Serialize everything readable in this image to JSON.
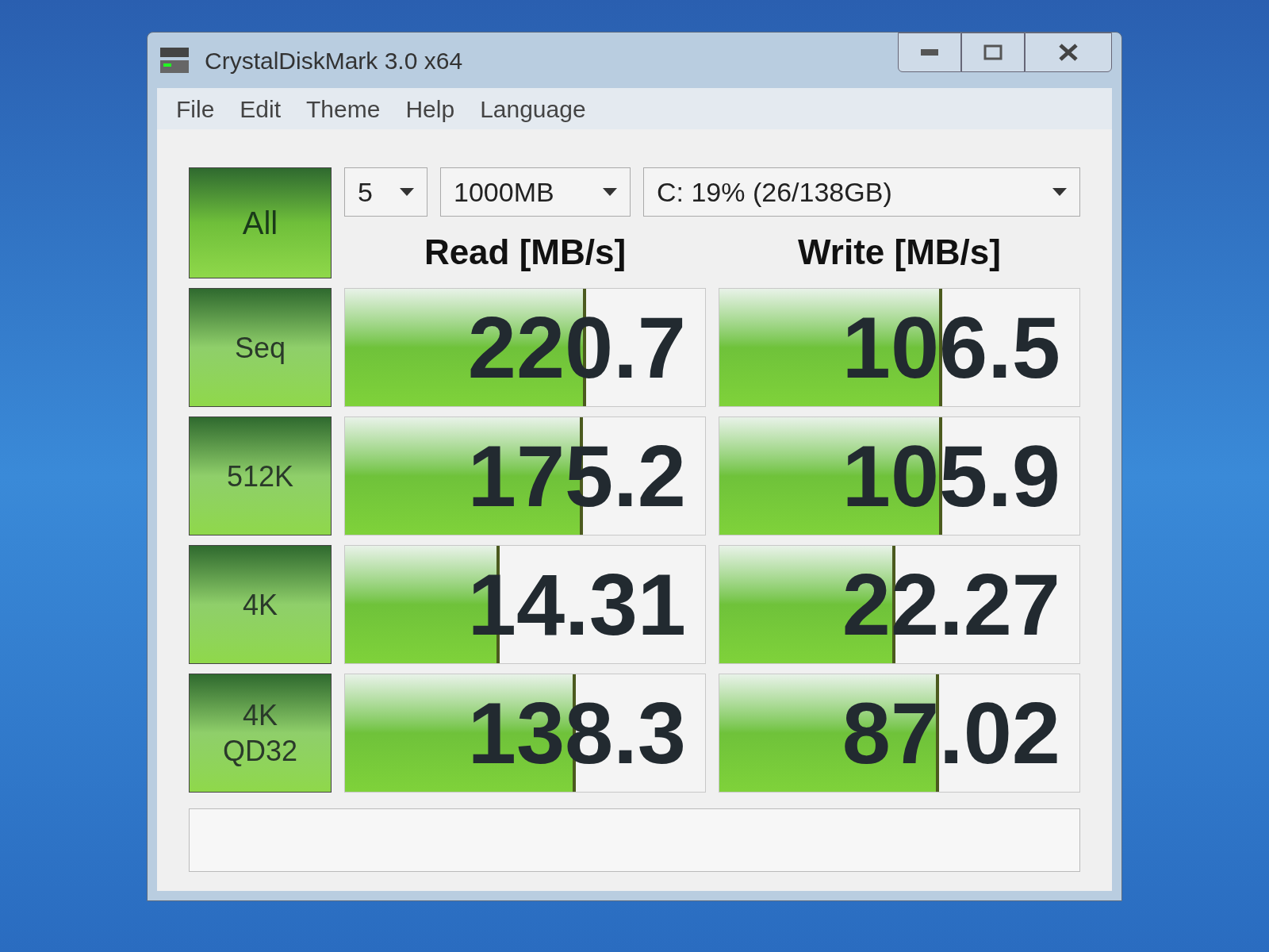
{
  "window": {
    "title": "CrystalDiskMark 3.0 x64"
  },
  "menu": [
    "File",
    "Edit",
    "Theme",
    "Help",
    "Language"
  ],
  "all_button": "All",
  "selectors": [
    {
      "value": "5"
    },
    {
      "value": "1000MB"
    },
    {
      "value": "C: 19% (26/138GB)"
    }
  ],
  "columns": [
    "Read [MB/s]",
    "Write [MB/s]"
  ],
  "rows": [
    {
      "label": [
        "Seq"
      ],
      "read": {
        "value": "220.7",
        "level": 0.67
      },
      "write": {
        "value": "106.5",
        "level": 0.62
      }
    },
    {
      "label": [
        "512K"
      ],
      "read": {
        "value": "175.2",
        "level": 0.66
      },
      "write": {
        "value": "105.9",
        "level": 0.62
      }
    },
    {
      "label": [
        "4K"
      ],
      "read": {
        "value": "14.31",
        "level": 0.43
      },
      "write": {
        "value": "22.27",
        "level": 0.49
      }
    },
    {
      "label": [
        "4K",
        "QD32"
      ],
      "read": {
        "value": "138.3",
        "level": 0.64
      },
      "write": {
        "value": "87.02",
        "level": 0.61
      }
    }
  ]
}
